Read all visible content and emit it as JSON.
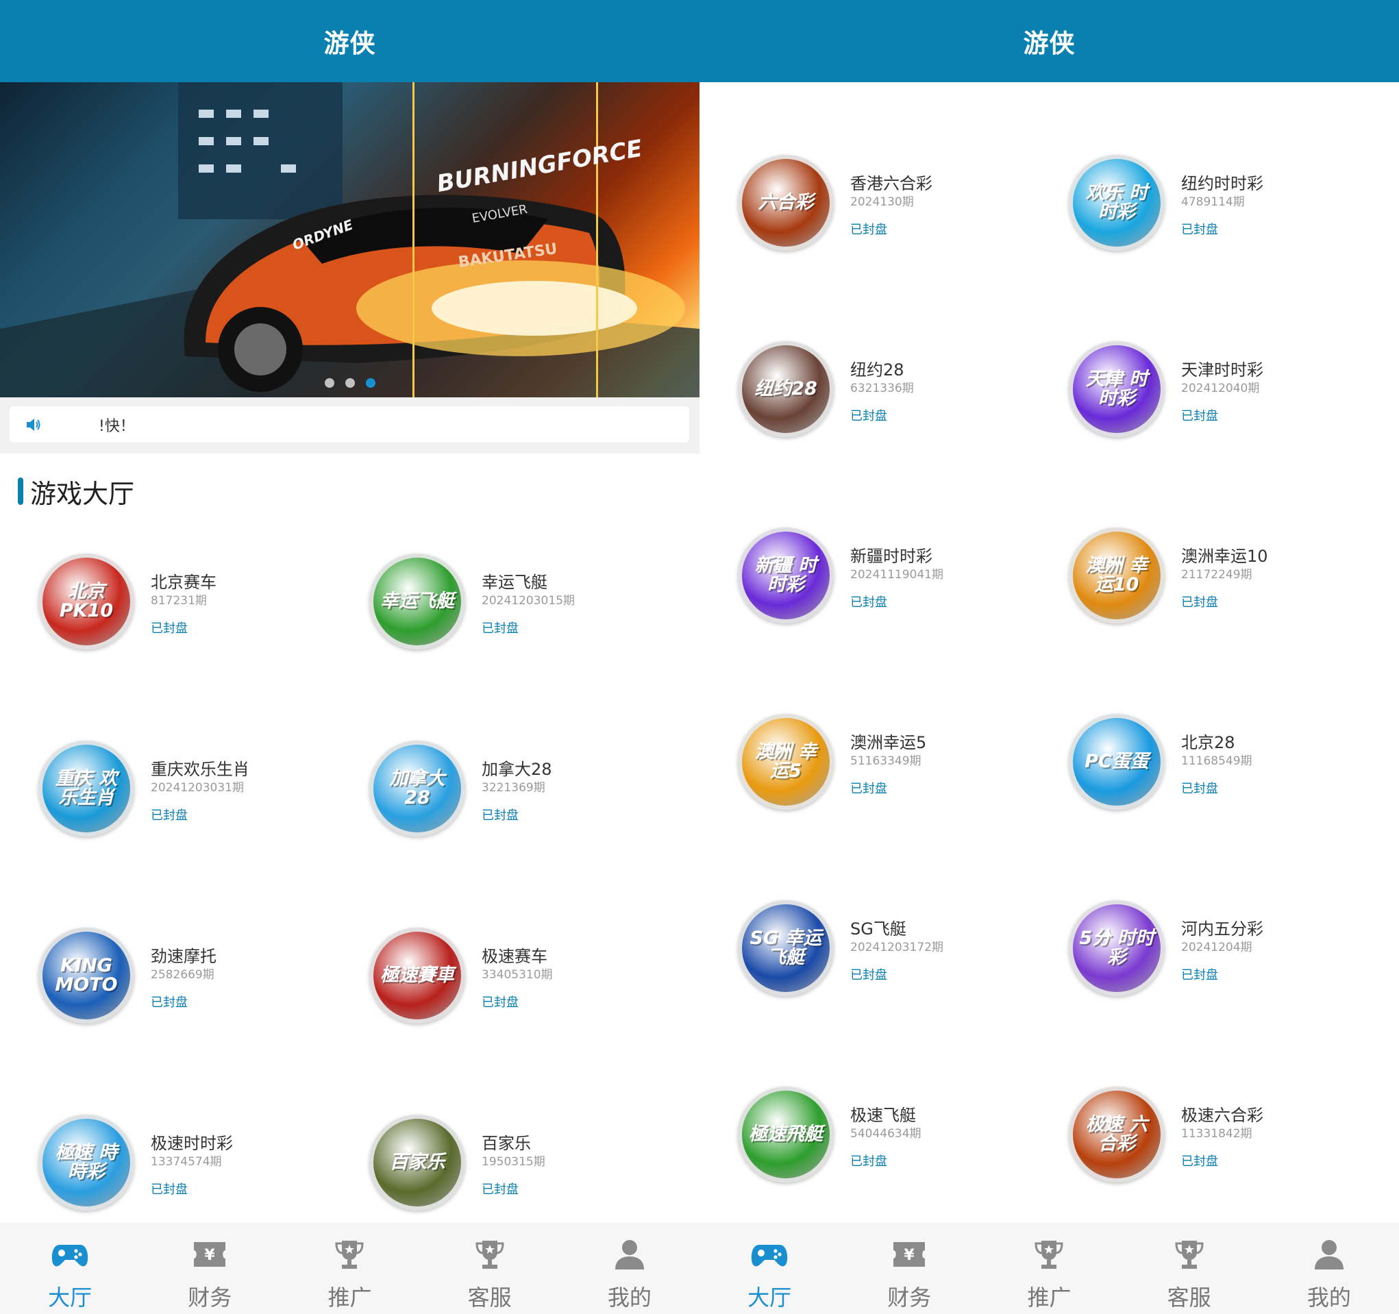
{
  "colors": {
    "primary": "#0a80b0",
    "tab_active": "#1a8fd0",
    "tab_inactive": "#8a8a8a",
    "status": "#0a80b0"
  },
  "left": {
    "header": {
      "title": "游侠"
    },
    "banner": {
      "car_texts": [
        "BURNINGFORCE",
        "EVOLVER",
        "BAKUTATSU",
        "ORDYNE"
      ],
      "slides": 3,
      "active_slide": 3
    },
    "notice": {
      "icon": "speaker-icon",
      "text": "!快！"
    },
    "section": {
      "title": "游戏大厅"
    },
    "games": [
      {
        "name": "北京赛车",
        "issue": "817231期",
        "status": "已封盘",
        "icon_text": "北京PK10",
        "color": "#c8281e"
      },
      {
        "name": "幸运飞艇",
        "issue": "20241203015期",
        "status": "已封盘",
        "icon_text": "幸运飞艇",
        "color": "#2e9e2e"
      },
      {
        "name": "重庆欢乐生肖",
        "issue": "20241203031期",
        "status": "已封盘",
        "icon_text": "重庆 欢乐生肖",
        "color": "#1a9ad8"
      },
      {
        "name": "加拿大28",
        "issue": "3221369期",
        "status": "已封盘",
        "icon_text": "加拿大28",
        "color": "#2aa0e0"
      },
      {
        "name": "劲速摩托",
        "issue": "2582669期",
        "status": "已封盘",
        "icon_text": "KING MOTO",
        "color": "#1b5fb8"
      },
      {
        "name": "极速赛车",
        "issue": "33405310期",
        "status": "已封盘",
        "icon_text": "極速賽車",
        "color": "#b8201c"
      },
      {
        "name": "极速时时彩",
        "issue": "13374574期",
        "status": "已封盘",
        "icon_text": "極速 時時彩",
        "color": "#2a9ee0"
      },
      {
        "name": "百家乐",
        "issue": "1950315期",
        "status": "已封盘",
        "icon_text": "百家乐",
        "color": "#5a6a2c"
      }
    ],
    "tabs": [
      {
        "label": "大厅",
        "icon": "gamepad-icon",
        "active": true
      },
      {
        "label": "财务",
        "icon": "ticket-yen-icon",
        "active": false
      },
      {
        "label": "推广",
        "icon": "trophy-icon",
        "active": false
      },
      {
        "label": "客服",
        "icon": "trophy-icon",
        "active": false
      },
      {
        "label": "我的",
        "icon": "user-icon",
        "active": false
      }
    ]
  },
  "right": {
    "header": {
      "title": "游侠"
    },
    "games": [
      {
        "name": "香港六合彩",
        "issue": "2024130期",
        "status": "已封盘",
        "icon_text": "六合彩",
        "color": "#a63a10"
      },
      {
        "name": "纽约时时彩",
        "issue": "4789114期",
        "status": "已封盘",
        "icon_text": "欢乐 时时彩",
        "color": "#1aa6e0"
      },
      {
        "name": "纽约28",
        "issue": "6321336期",
        "status": "已封盘",
        "icon_text": "纽约28",
        "color": "#6a4236"
      },
      {
        "name": "天津时时彩",
        "issue": "202412040期",
        "status": "已封盘",
        "icon_text": "天津 时时彩",
        "color": "#6a2ad8"
      },
      {
        "name": "新疆时时彩",
        "issue": "20241119041期",
        "status": "已封盘",
        "icon_text": "新疆 时时彩",
        "color": "#6a2ad8"
      },
      {
        "name": "澳洲幸运10",
        "issue": "21172249期",
        "status": "已封盘",
        "icon_text": "澳洲 幸运10",
        "color": "#e08a10"
      },
      {
        "name": "澳洲幸运5",
        "issue": "51163349期",
        "status": "已封盘",
        "icon_text": "澳洲 幸运5",
        "color": "#e89a10"
      },
      {
        "name": "北京28",
        "issue": "11168549期",
        "status": "已封盘",
        "icon_text": "PC蛋蛋",
        "color": "#1a9ae0"
      },
      {
        "name": "SG飞艇",
        "issue": "20241203172期",
        "status": "已封盘",
        "icon_text": "SG 幸运飞艇",
        "color": "#1a4aa8"
      },
      {
        "name": "河内五分彩",
        "issue": "20241204期",
        "status": "已封盘",
        "icon_text": "5分 时时彩",
        "color": "#7a3ad0"
      },
      {
        "name": "极速飞艇",
        "issue": "54044634期",
        "status": "已封盘",
        "icon_text": "極速飛艇",
        "color": "#2e9e2e"
      },
      {
        "name": "极速六合彩",
        "issue": "11331842期",
        "status": "已封盘",
        "icon_text": "极速 六合彩",
        "color": "#b8400c"
      }
    ],
    "tabs": [
      {
        "label": "大厅",
        "icon": "gamepad-icon",
        "active": true
      },
      {
        "label": "财务",
        "icon": "ticket-yen-icon",
        "active": false
      },
      {
        "label": "推广",
        "icon": "trophy-icon",
        "active": false
      },
      {
        "label": "客服",
        "icon": "trophy-icon",
        "active": false
      },
      {
        "label": "我的",
        "icon": "user-icon",
        "active": false
      }
    ]
  }
}
